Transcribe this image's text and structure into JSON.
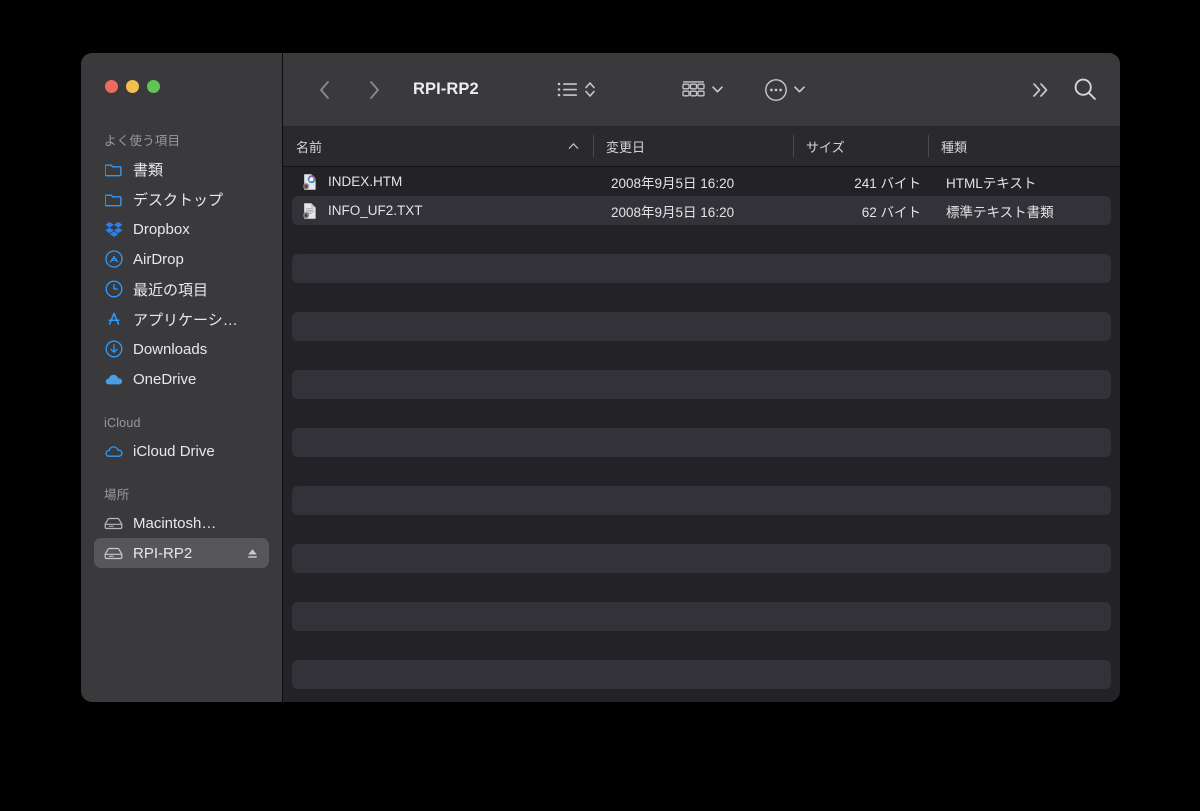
{
  "window": {
    "title": "RPI-RP2",
    "traffic_lights": [
      {
        "name": "close",
        "color": "#ED6A5E"
      },
      {
        "name": "minimize",
        "color": "#F4BD4F"
      },
      {
        "name": "zoom",
        "color": "#61C554"
      }
    ]
  },
  "toolbar": {
    "back_icon": "chevron-left-icon",
    "forward_icon": "chevron-right-icon",
    "view_icon": "list-view-icon",
    "view_stepper_icon": "chevron-up-down-icon",
    "group_icon": "group-by-icon",
    "group_chevron_icon": "chevron-down-icon",
    "action_icon": "ellipsis-circle-icon",
    "action_chevron_icon": "chevron-down-icon",
    "overflow_icon": "chevron-double-right-icon",
    "search_icon": "search-icon"
  },
  "sidebar": {
    "sections": [
      {
        "label": "よく使う項目",
        "items": [
          {
            "label": "書類",
            "icon": "folder-icon",
            "selected": false
          },
          {
            "label": "デスクトップ",
            "icon": "folder-icon",
            "selected": false
          },
          {
            "label": "Dropbox",
            "icon": "dropbox-icon",
            "selected": false
          },
          {
            "label": "AirDrop",
            "icon": "airdrop-icon",
            "selected": false
          },
          {
            "label": "最近の項目",
            "icon": "clock-icon",
            "selected": false
          },
          {
            "label": "アプリケーシ…",
            "icon": "appstore-icon",
            "selected": false
          },
          {
            "label": "Downloads",
            "icon": "download-icon",
            "selected": false
          },
          {
            "label": "OneDrive",
            "icon": "cloud-icon",
            "selected": false
          }
        ]
      },
      {
        "label": "iCloud",
        "items": [
          {
            "label": "iCloud Drive",
            "icon": "icloud-icon",
            "selected": false
          }
        ]
      },
      {
        "label": "場所",
        "items": [
          {
            "label": "Macintosh…",
            "icon": "drive-icon",
            "selected": false
          },
          {
            "label": "RPI-RP2",
            "icon": "drive-icon",
            "selected": true,
            "eject_icon": "eject-icon"
          }
        ]
      }
    ]
  },
  "file_table": {
    "columns": [
      {
        "key": "name",
        "label": "名前",
        "sorted": true,
        "sort_icon": "chevron-up-icon"
      },
      {
        "key": "date",
        "label": "変更日",
        "sorted": false
      },
      {
        "key": "size",
        "label": "サイズ",
        "sorted": false
      },
      {
        "key": "kind",
        "label": "種類",
        "sorted": false
      }
    ],
    "rows": [
      {
        "name": "INDEX.HTM",
        "date": "2008年9月5日 16:20",
        "size": "241 バイト",
        "kind": "HTMLテキスト",
        "icon": "chrome-document-icon"
      },
      {
        "name": "INFO_UF2.TXT",
        "date": "2008年9月5日 16:20",
        "size": "62 バイト",
        "kind": "標準テキスト書類",
        "icon": "text-document-icon"
      }
    ],
    "empty_row_count": 16
  },
  "colors": {
    "desktop": "#000000",
    "sidebar_bg": "#3A3A3C",
    "toolbar_bg": "#3A3A3C",
    "content_bg": "#232327",
    "stripe_row": "#323238",
    "header_bg": "#2A2A2E",
    "selection": "#575759",
    "accent_blue": "#1A8CFF"
  }
}
